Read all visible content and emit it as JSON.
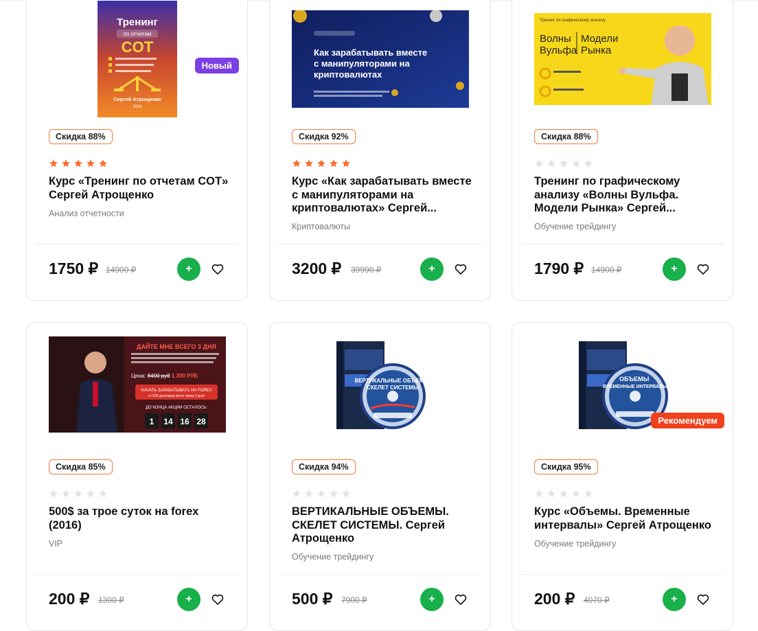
{
  "labels": {
    "new": "Новый",
    "recommend": "Рекомендуем",
    "add_symbol": "+",
    "currency": "₽"
  },
  "colors": {
    "accent_green": "#17b04a",
    "new_badge": "#7b3fe4",
    "recommend_badge": "#f2411d",
    "discount_border": "#f07a3a",
    "star_active": "#ff6b2c",
    "star_inactive": "#e3e3e3"
  },
  "products": [
    {
      "image": {
        "cover_title": "Тренинг",
        "cover_subtitle": "по отчетам",
        "cover_main": "COT",
        "cover_author": "Сергей Атрощенко",
        "cover_year": "2024"
      },
      "discount": "Скидка 88%",
      "rating": 5,
      "is_new": true,
      "title": "Курс «Тренинг по отчетам COT» Сергей Атрощенко",
      "category": "Анализ отчетности",
      "price": "1750 ₽",
      "old_price": "14900 ₽"
    },
    {
      "image": {
        "banner_title": "Как зарабатывать вместе с манипуляторами на криптовалютах"
      },
      "discount": "Скидка 92%",
      "rating": 5,
      "title": "Курс «Как зарабатывать вместе с манипуляторами на криптовалютах» Сергей...",
      "category": "Криптовалюты",
      "price": "3200 ₽",
      "old_price": "39990 ₽"
    },
    {
      "image": {
        "banner_top": "Тренинг по графическому анализу",
        "banner_left": "Волны Вульфа",
        "banner_right": "Модели Рынка"
      },
      "discount": "Скидка 88%",
      "rating": 0,
      "title": "Тренинг по графическому анализу «Волны Вульфа. Модели Рынка» Сергей...",
      "category": "Обучение трейдингу",
      "price": "1790 ₽",
      "old_price": "14900 ₽"
    },
    {
      "image": {
        "banner_title": "ДАЙТЕ МНЕ ВСЕГО 3 ДНЯ",
        "countdown": [
          "1",
          "14",
          "16",
          "28"
        ]
      },
      "discount": "Скидка 85%",
      "rating": 0,
      "title": "500$ за трое суток на forex (2016)",
      "category": "VIP",
      "price": "200 ₽",
      "old_price": "1300 ₽"
    },
    {
      "image": {
        "box_title": "ВЕРТИКАЛЬНЫЕ ОБЪЕМЫ СКЕЛЕТ СИСТЕМЫ"
      },
      "discount": "Скидка 94%",
      "rating": 0,
      "title": "ВЕРТИКАЛЬНЫЕ ОБЪЕМЫ. СКЕЛЕТ СИСТЕМЫ. Сергей Атрощенко",
      "category": "Обучение трейдингу",
      "price": "500 ₽",
      "old_price": "7900 ₽"
    },
    {
      "image": {
        "box_title": "ОБЪЕМЫ ВРЕМЕННЫЕ ИНТЕРВАЛЫ"
      },
      "discount": "Скидка 95%",
      "rating": 0,
      "is_recommended": true,
      "title": "Курс «Объемы. Временные интервалы» Сергей Атрощенко",
      "category": "Обучение трейдингу",
      "price": "200 ₽",
      "old_price": "4070 ₽"
    }
  ]
}
